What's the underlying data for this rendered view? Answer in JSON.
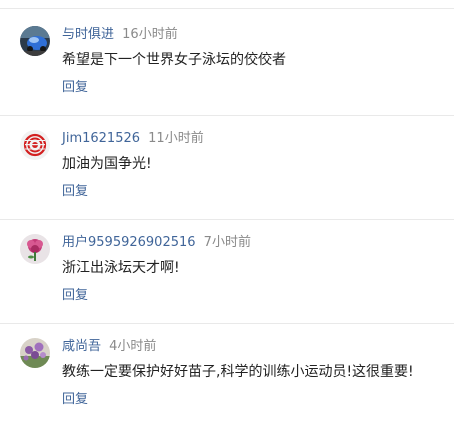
{
  "comments": [
    {
      "username": "与时俱进",
      "time": "16小时前",
      "text": "希望是下一个世界女子泳坛的佼佼者",
      "reply_label": "回复",
      "avatar_icon": "blue-car-photo-avatar"
    },
    {
      "username": "Jim1621526",
      "time": "11小时前",
      "text": "加油为国争光!",
      "reply_label": "回复",
      "avatar_icon": "red-dot-logo-avatar"
    },
    {
      "username": "用户9595926902516",
      "time": "7小时前",
      "text": "浙江出泳坛天才啊!",
      "reply_label": "回复",
      "avatar_icon": "pink-flower-avatar"
    },
    {
      "username": "咸尚吾",
      "time": "4小时前",
      "text": "教练一定要保护好好苗子,科学的训练小运动员!这很重要!",
      "reply_label": "回复",
      "avatar_icon": "purple-flowers-photo-avatar"
    }
  ]
}
